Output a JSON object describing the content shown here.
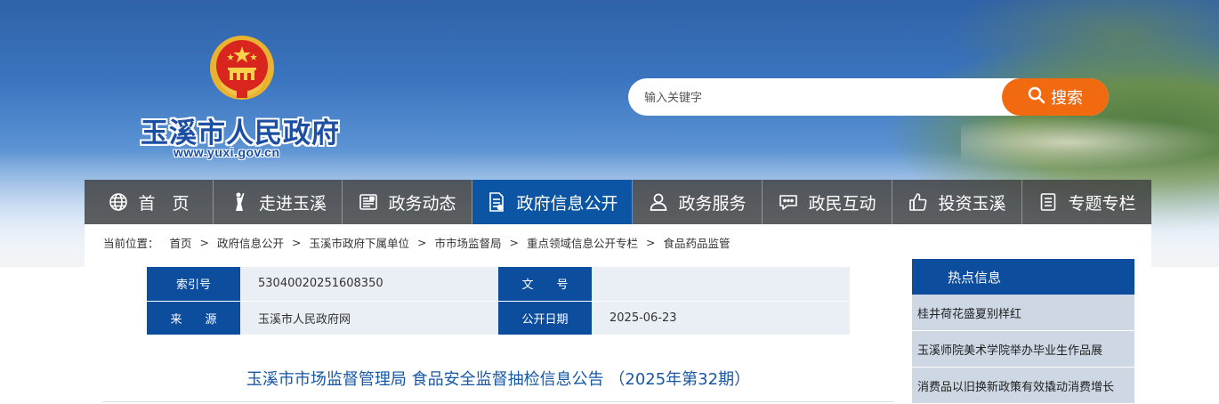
{
  "header": {
    "site_title": "玉溪市人民政府",
    "site_url": "www.yuxi.gov.cn",
    "emblem_icon": "national-emblem-icon"
  },
  "search": {
    "placeholder": "输入关键字",
    "button_label": "搜索",
    "button_color": "#f26a10"
  },
  "nav": {
    "active_color": "#0c55a5",
    "items": [
      {
        "label": "首　页",
        "icon": "globe-icon"
      },
      {
        "label": "走进玉溪",
        "icon": "statue-icon"
      },
      {
        "label": "政务动态",
        "icon": "newspaper-icon"
      },
      {
        "label": "政府信息公开",
        "icon": "document-icon",
        "active": true
      },
      {
        "label": "政务服务",
        "icon": "person-icon"
      },
      {
        "label": "政民互动",
        "icon": "chat-icon"
      },
      {
        "label": "投资玉溪",
        "icon": "thumbs-up-icon"
      },
      {
        "label": "专题专栏",
        "icon": "list-icon"
      }
    ]
  },
  "breadcrumb": {
    "label": "当前位置：",
    "items": [
      "首页",
      "政府信息公开",
      "玉溪市政府下属单位",
      "市市场监督局",
      "重点领域信息公开专栏",
      "食品药品监管"
    ]
  },
  "info": {
    "index_label": "索引号",
    "index_value": "53040020251608350",
    "doc_no_label": "文　　号",
    "doc_no_value": "",
    "source_label": "来　　源",
    "source_value": "玉溪市人民政府网",
    "date_label": "公开日期",
    "date_value": "2025-06-23"
  },
  "article": {
    "title": "玉溪市市场监督管理局 食品安全监督抽检信息公告 （2025年第32期）"
  },
  "hot_news": {
    "header": "热点信息",
    "items": [
      "桂井荷花盛夏别样红",
      "玉溪师院美术学院举办毕业生作品展",
      "消费品以旧换新政策有效撬动消费增长"
    ]
  }
}
